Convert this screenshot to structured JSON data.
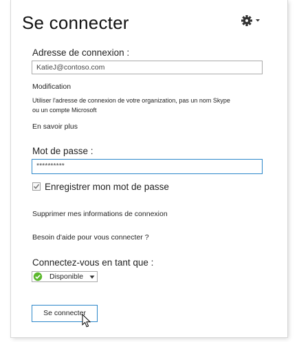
{
  "header": {
    "title": "Se connecter",
    "settings_icon": "gear-icon"
  },
  "signin_address": {
    "label": "Adresse de connexion :",
    "value": "KatieJ@contoso.com"
  },
  "modification": {
    "heading": "Modification",
    "help_line1": "Utiliser l'adresse de connexion de votre organization, pas un nom Skype",
    "help_line2": "ou un compte Microsoft",
    "learn_more": "En savoir plus"
  },
  "password": {
    "label": "Mot de passe :",
    "value": "**********"
  },
  "save_password": {
    "label": "Enregistrer mon mot de passe",
    "checked": true
  },
  "links": {
    "delete_info": "Supprimer mes informations de connexion",
    "help": "Besoin d'aide pour vous connecter ?"
  },
  "status": {
    "label": "Connectez-vous en tant que :",
    "selected": "Disponible",
    "color": "#5cb82e"
  },
  "signin_button": {
    "label": "Se connecter"
  }
}
